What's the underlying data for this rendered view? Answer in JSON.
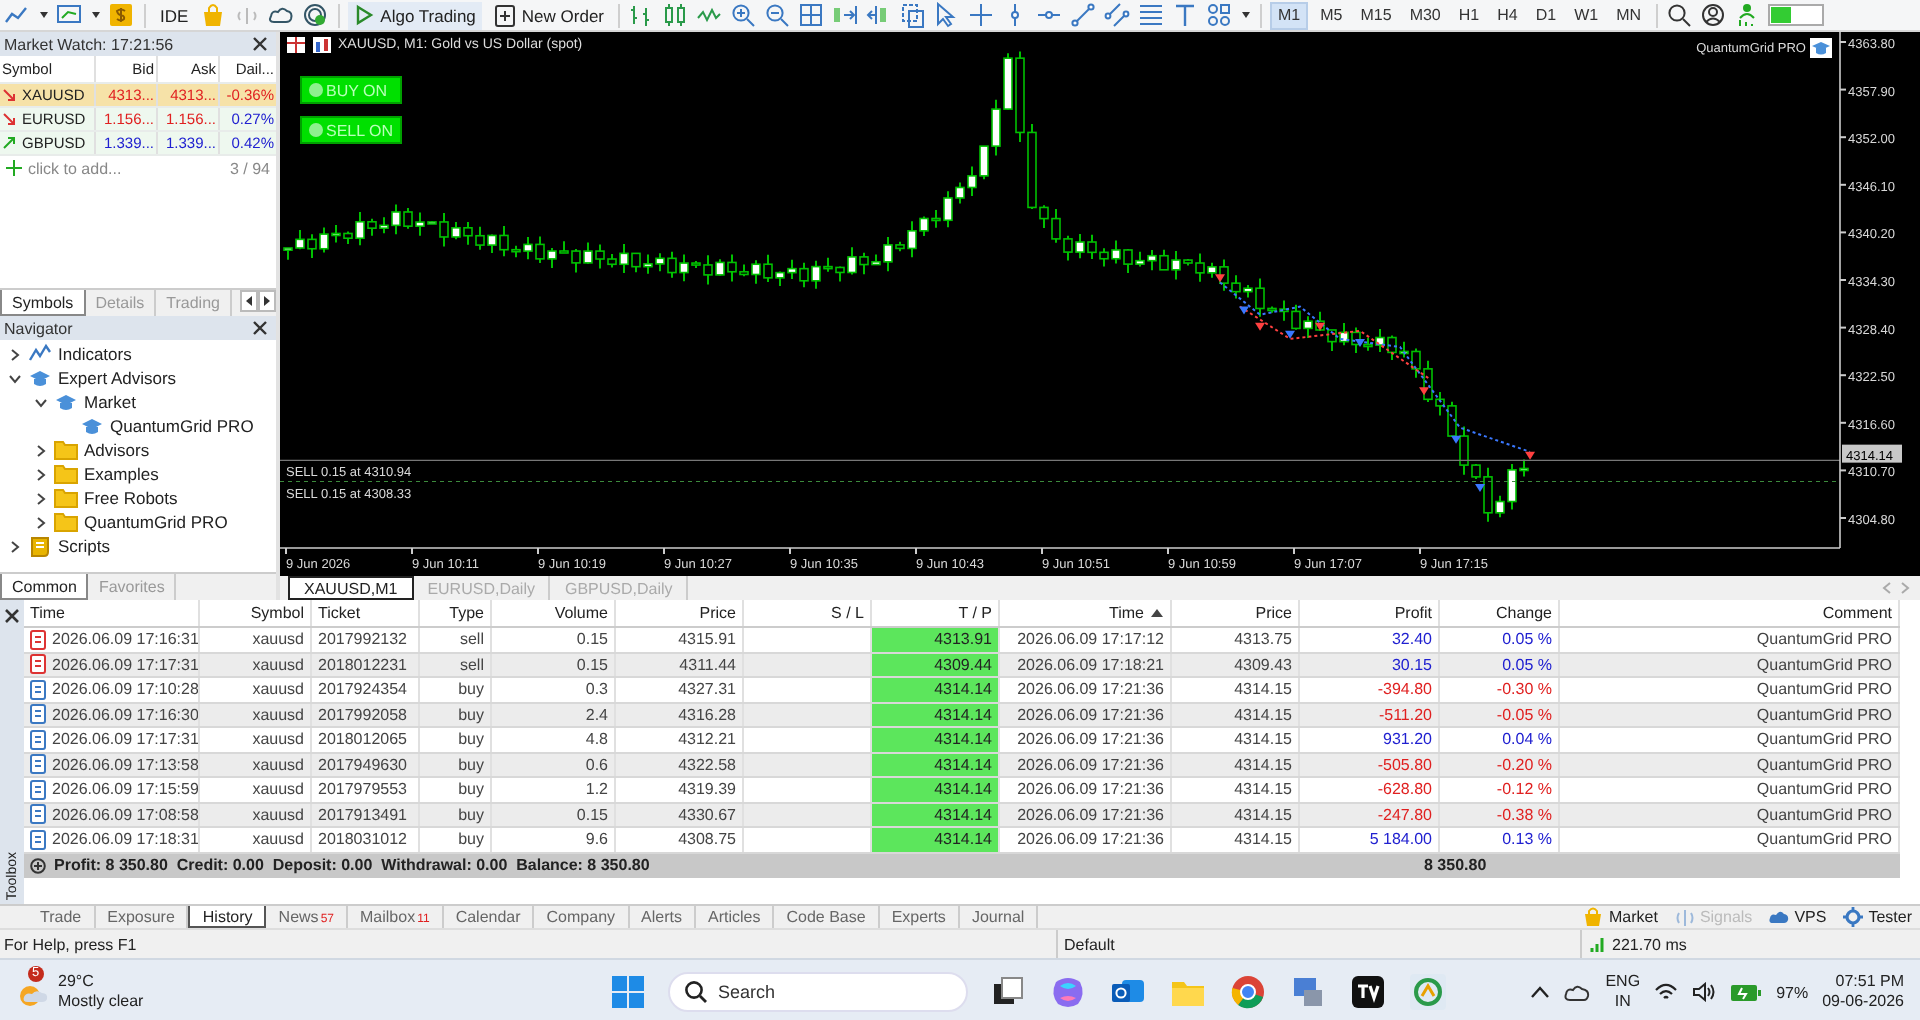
{
  "toolbar": {
    "ide": "IDE",
    "algo_trading": "Algo Trading",
    "new_order": "New Order",
    "timeframes": [
      {
        "label": "M1",
        "selected": true
      },
      {
        "label": "M5",
        "selected": false
      },
      {
        "label": "M15",
        "selected": false
      },
      {
        "label": "M30",
        "selected": false
      },
      {
        "label": "H1",
        "selected": false
      },
      {
        "label": "H4",
        "selected": false
      },
      {
        "label": "D1",
        "selected": false
      },
      {
        "label": "W1",
        "selected": false
      },
      {
        "label": "MN",
        "selected": false
      }
    ]
  },
  "market_watch": {
    "title": "Market Watch: 17:21:56",
    "columns": [
      "Symbol",
      "Bid",
      "Ask",
      "Dail..."
    ],
    "rows": [
      {
        "symbol": "XAUUSD",
        "bid": "4313...",
        "ask": "4313...",
        "daily": "-0.36%",
        "rising": false,
        "daily_positive": false,
        "selected": true
      },
      {
        "symbol": "EURUSD",
        "bid": "1.156...",
        "ask": "1.156...",
        "daily": "0.27%",
        "rising": false,
        "daily_positive": true,
        "selected": false
      },
      {
        "symbol": "GBPUSD",
        "bid": "1.339...",
        "ask": "1.339...",
        "daily": "0.42%",
        "rising": true,
        "daily_positive": true,
        "selected": false
      }
    ],
    "add_hint": "click to add...",
    "count": "3 / 94",
    "tabs": [
      {
        "label": "Symbols",
        "selected": true
      },
      {
        "label": "Details",
        "selected": false
      },
      {
        "label": "Trading",
        "selected": false
      }
    ]
  },
  "navigator": {
    "title": "Navigator",
    "tree": [
      {
        "label": "Indicators",
        "kind": "indicator",
        "expanded": false
      },
      {
        "label": "Expert Advisors",
        "kind": "expert",
        "expanded": true,
        "children": [
          {
            "label": "Market",
            "kind": "expert",
            "expanded": true,
            "children": [
              {
                "label": "QuantumGrid PRO",
                "kind": "expert"
              }
            ]
          },
          {
            "label": "Advisors",
            "kind": "folder",
            "expanded": false
          },
          {
            "label": "Examples",
            "kind": "folder",
            "expanded": false
          },
          {
            "label": "Free Robots",
            "kind": "folder",
            "expanded": false
          },
          {
            "label": "QuantumGrid PRO",
            "kind": "folder",
            "expanded": false
          }
        ]
      },
      {
        "label": "Scripts",
        "kind": "script",
        "expanded": false
      }
    ],
    "tabs": [
      {
        "label": "Common",
        "selected": true
      },
      {
        "label": "Favorites",
        "selected": false
      }
    ]
  },
  "chart": {
    "title": "XAUUSD, M1:  Gold vs US Dollar (spot)",
    "buttons": [
      "BUY ON",
      "SELL ON"
    ],
    "expert": "QuantumGrid PRO",
    "price_labels": [
      "4363.80",
      "4357.90",
      "4352.00",
      "4346.10",
      "4340.20",
      "4334.30",
      "4328.40",
      "4322.50",
      "4316.60",
      "4310.70",
      "4304.80"
    ],
    "current_price": "4314.14",
    "time_labels": [
      "9 Jun 2026",
      "9 Jun 10:11",
      "9 Jun 10:19",
      "9 Jun 10:27",
      "9 Jun 10:35",
      "9 Jun 10:43",
      "9 Jun 10:51",
      "9 Jun 10:59",
      "9 Jun 17:07",
      "9 Jun 17:15"
    ],
    "trade_lines": [
      "SELL 0.15 at 4310.94",
      "SELL 0.15 at 4308.33"
    ],
    "tabs": [
      {
        "label": "XAUUSD,M1",
        "selected": true
      },
      {
        "label": "EURUSD,Daily",
        "selected": false
      },
      {
        "label": "GBPUSD,Daily",
        "selected": false
      }
    ]
  },
  "history": {
    "columns": [
      {
        "label": "Time",
        "sorted": false
      },
      {
        "label": "Symbol",
        "sorted": false
      },
      {
        "label": "Ticket",
        "sorted": false
      },
      {
        "label": "Type",
        "sorted": false
      },
      {
        "label": "Volume",
        "sorted": false
      },
      {
        "label": "Price",
        "sorted": false
      },
      {
        "label": "S / L",
        "sorted": false
      },
      {
        "label": "T / P",
        "sorted": false
      },
      {
        "label": "Time",
        "sorted": true
      },
      {
        "label": "Price",
        "sorted": false
      },
      {
        "label": "Profit",
        "sorted": false
      },
      {
        "label": "Change",
        "sorted": false
      },
      {
        "label": "Comment",
        "sorted": false
      }
    ],
    "rows": [
      {
        "kind": "sell",
        "time": "2026.06.09 17:16:31",
        "symbol": "xauusd",
        "ticket": "2017992132",
        "type": "sell",
        "volume": "0.15",
        "price": "4315.91",
        "tp": "4313.91",
        "close_time": "2026.06.09 17:17:12",
        "close_price": "4313.75",
        "profit": "32.40",
        "change": "0.05 %",
        "profit_positive": true,
        "comment": "QuantumGrid PRO"
      },
      {
        "kind": "sell",
        "time": "2026.06.09 17:17:31",
        "symbol": "xauusd",
        "ticket": "2018012231",
        "type": "sell",
        "volume": "0.15",
        "price": "4311.44",
        "tp": "4309.44",
        "close_time": "2026.06.09 17:18:21",
        "close_price": "4309.43",
        "profit": "30.15",
        "change": "0.05 %",
        "profit_positive": true,
        "comment": "QuantumGrid PRO"
      },
      {
        "kind": "buy",
        "time": "2026.06.09 17:10:28",
        "symbol": "xauusd",
        "ticket": "2017924354",
        "type": "buy",
        "volume": "0.3",
        "price": "4327.31",
        "tp": "4314.14",
        "close_time": "2026.06.09 17:21:36",
        "close_price": "4314.15",
        "profit": "-394.80",
        "change": "-0.30 %",
        "profit_positive": false,
        "comment": "QuantumGrid PRO"
      },
      {
        "kind": "buy",
        "time": "2026.06.09 17:16:30",
        "symbol": "xauusd",
        "ticket": "2017992058",
        "type": "buy",
        "volume": "2.4",
        "price": "4316.28",
        "tp": "4314.14",
        "close_time": "2026.06.09 17:21:36",
        "close_price": "4314.15",
        "profit": "-511.20",
        "change": "-0.05 %",
        "profit_positive": false,
        "comment": "QuantumGrid PRO"
      },
      {
        "kind": "buy",
        "time": "2026.06.09 17:17:31",
        "symbol": "xauusd",
        "ticket": "2018012065",
        "type": "buy",
        "volume": "4.8",
        "price": "4312.21",
        "tp": "4314.14",
        "close_time": "2026.06.09 17:21:36",
        "close_price": "4314.15",
        "profit": "931.20",
        "change": "0.04 %",
        "profit_positive": true,
        "comment": "QuantumGrid PRO"
      },
      {
        "kind": "buy",
        "time": "2026.06.09 17:13:58",
        "symbol": "xauusd",
        "ticket": "2017949630",
        "type": "buy",
        "volume": "0.6",
        "price": "4322.58",
        "tp": "4314.14",
        "close_time": "2026.06.09 17:21:36",
        "close_price": "4314.15",
        "profit": "-505.80",
        "change": "-0.20 %",
        "profit_positive": false,
        "comment": "QuantumGrid PRO"
      },
      {
        "kind": "buy",
        "time": "2026.06.09 17:15:59",
        "symbol": "xauusd",
        "ticket": "2017979553",
        "type": "buy",
        "volume": "1.2",
        "price": "4319.39",
        "tp": "4314.14",
        "close_time": "2026.06.09 17:21:36",
        "close_price": "4314.15",
        "profit": "-628.80",
        "change": "-0.12 %",
        "profit_positive": false,
        "comment": "QuantumGrid PRO"
      },
      {
        "kind": "buy",
        "time": "2026.06.09 17:08:58",
        "symbol": "xauusd",
        "ticket": "2017913491",
        "type": "buy",
        "volume": "0.15",
        "price": "4330.67",
        "tp": "4314.14",
        "close_time": "2026.06.09 17:21:36",
        "close_price": "4314.15",
        "profit": "-247.80",
        "change": "-0.38 %",
        "profit_positive": false,
        "comment": "QuantumGrid PRO"
      },
      {
        "kind": "buy",
        "time": "2026.06.09 17:18:31",
        "symbol": "xauusd",
        "ticket": "2018031012",
        "type": "buy",
        "volume": "9.6",
        "price": "4308.75",
        "tp": "4314.14",
        "close_time": "2026.06.09 17:21:36",
        "close_price": "4314.15",
        "profit": "5 184.00",
        "change": "0.13 %",
        "profit_positive": true,
        "comment": "QuantumGrid PRO"
      }
    ],
    "summary": "Profit: 8 350.80  Credit: 0.00  Deposit: 0.00  Withdrawal: 0.00  Balance: 8 350.80",
    "total": "8 350.80"
  },
  "toolbox": {
    "title": "Toolbox",
    "tabs": [
      {
        "label": "Trade",
        "selected": false
      },
      {
        "label": "Exposure",
        "selected": false
      },
      {
        "label": "History",
        "selected": true
      },
      {
        "label": "News",
        "badge": "57",
        "selected": false
      },
      {
        "label": "Mailbox",
        "badge": "11",
        "selected": false
      },
      {
        "label": "Calendar",
        "selected": false
      },
      {
        "label": "Company",
        "selected": false
      },
      {
        "label": "Alerts",
        "selected": false
      },
      {
        "label": "Articles",
        "selected": false
      },
      {
        "label": "Code Base",
        "selected": false
      },
      {
        "label": "Experts",
        "selected": false
      },
      {
        "label": "Journal",
        "selected": false
      }
    ],
    "services": [
      {
        "label": "Market",
        "kind": "market",
        "disabled": false
      },
      {
        "label": "Signals",
        "kind": "signals",
        "disabled": true
      },
      {
        "label": "VPS",
        "kind": "vps",
        "disabled": false
      },
      {
        "label": "Tester",
        "kind": "tester",
        "disabled": false
      }
    ]
  },
  "status_bar": {
    "help": "For Help, press F1",
    "profile": "Default",
    "ping": "221.70 ms"
  },
  "taskbar": {
    "weather_badge": "5",
    "temperature": "29°C",
    "weather": "Mostly clear",
    "search": {
      "placeholder": "Search"
    },
    "language": "ENG",
    "region": "IN",
    "battery": "97%",
    "time": "07:51 PM",
    "date": "09-06-2026"
  }
}
